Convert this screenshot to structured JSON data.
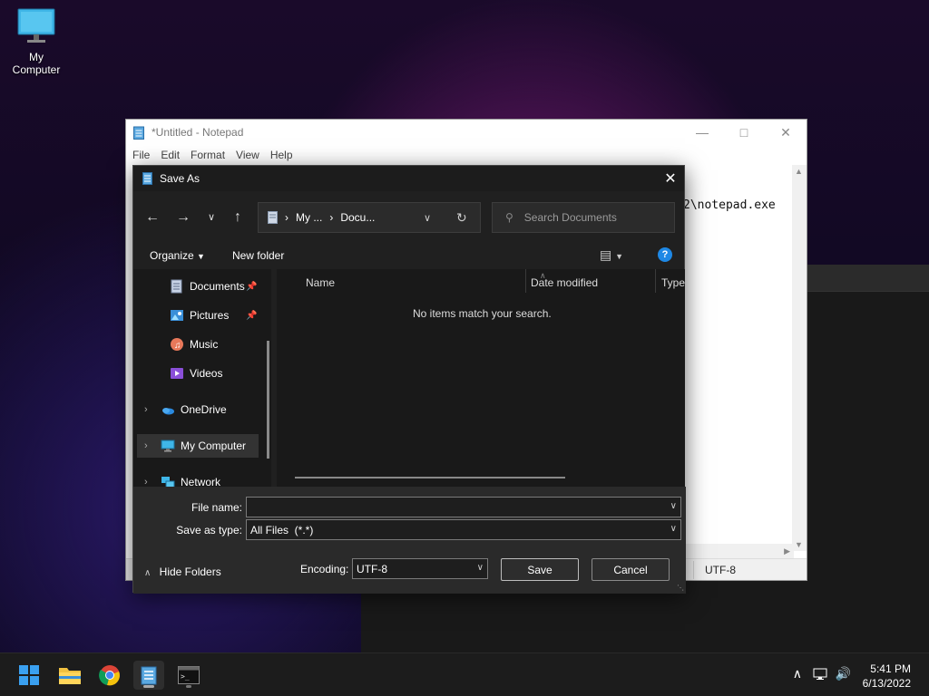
{
  "desktop": {
    "icons": [
      {
        "label": "My Computer",
        "icon": "monitor-icon"
      }
    ]
  },
  "notepad": {
    "title": "*Untitled - Notepad",
    "menu": [
      "File",
      "Edit",
      "Format",
      "View",
      "Help"
    ],
    "visible_text": "2\\notepad.exe",
    "status_encoding": "UTF-8"
  },
  "dialog": {
    "title": "Save As",
    "breadcrumb": [
      "My ...",
      "Docu..."
    ],
    "search_placeholder": "Search Documents",
    "organize_label": "Organize",
    "new_folder_label": "New folder",
    "nav_items": [
      {
        "label": "Documents",
        "icon": "documents-icon",
        "pinned": true
      },
      {
        "label": "Pictures",
        "icon": "pictures-icon",
        "pinned": true
      },
      {
        "label": "Music",
        "icon": "music-icon",
        "pinned": false
      },
      {
        "label": "Videos",
        "icon": "videos-icon",
        "pinned": false
      },
      {
        "label": "OneDrive",
        "icon": "onedrive-icon",
        "expandable": true
      },
      {
        "label": "My Computer",
        "icon": "computer-icon",
        "expandable": true,
        "selected": true
      },
      {
        "label": "Network",
        "icon": "network-icon",
        "expandable": true
      }
    ],
    "columns": [
      "Name",
      "Date modified",
      "Type"
    ],
    "empty_message": "No items match your search.",
    "file_name_label": "File name:",
    "file_name_value": "",
    "save_type_label": "Save as type:",
    "save_type_value": "All Files  (*.*)",
    "hide_folders_label": "Hide Folders",
    "encoding_label": "Encoding:",
    "encoding_value": "UTF-8",
    "save_label": "Save",
    "cancel_label": "Cancel"
  },
  "taskbar": {
    "apps": [
      "start-icon",
      "file-explorer-icon",
      "chrome-icon",
      "notepad-icon",
      "terminal-icon"
    ],
    "active_app": "notepad-icon",
    "time": "5:41 PM",
    "date": "6/13/2022"
  },
  "colors": {
    "accent": "#1e88e5",
    "dialog_bg": "#202020",
    "taskbar_bg": "#1c1c1c"
  }
}
